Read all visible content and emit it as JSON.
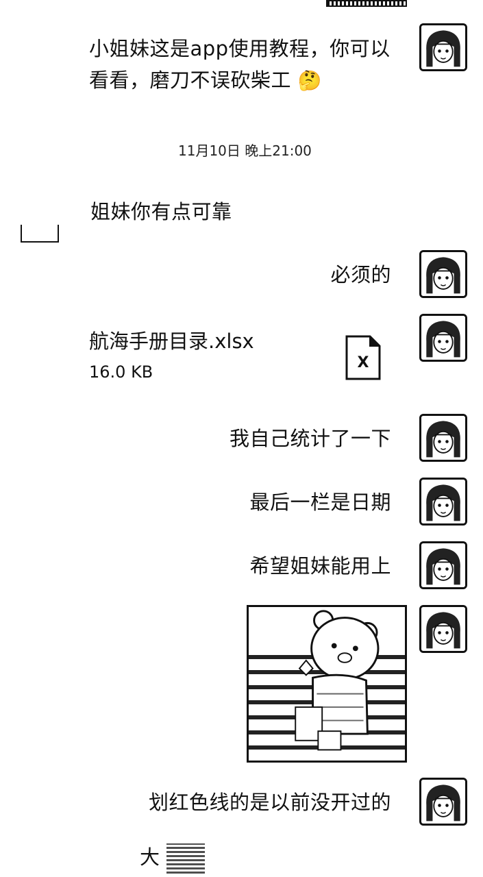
{
  "messages": [
    {
      "text_line1": "小姐妹这是app使用教程，你可以",
      "text_line2": "看看，磨刀不误砍柴工",
      "emoji": "thinking-face-icon"
    },
    {
      "timestamp": "11月10日 晚上21:00"
    },
    {
      "text": "姐妹你有点可靠"
    },
    {
      "text": "必须的"
    },
    {
      "file_name": "航海手册目录.xlsx",
      "file_size": "16.0 KB",
      "file_icon": "excel-file-icon"
    },
    {
      "text": "我自己统计了一下"
    },
    {
      "text": "最后一栏是日期"
    },
    {
      "text": "希望姐妹能用上"
    },
    {
      "sticker": "bear-sticker"
    },
    {
      "text": "划红色线的是以前没开过的"
    },
    {
      "text_prefix": "大"
    }
  ],
  "colors": {
    "background": "#ffffff",
    "text": "#111111",
    "border": "#111111"
  }
}
